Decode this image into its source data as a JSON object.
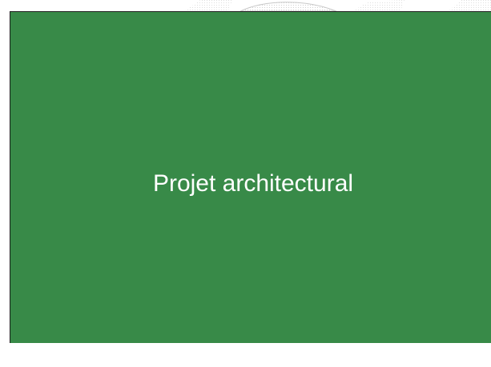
{
  "slide": {
    "title": "Projet architectural",
    "background_color": "#388a48",
    "text_color": "#ffffff"
  },
  "page": {
    "background_color": "#ffffff",
    "watermark_color": "#c8c8c8"
  }
}
